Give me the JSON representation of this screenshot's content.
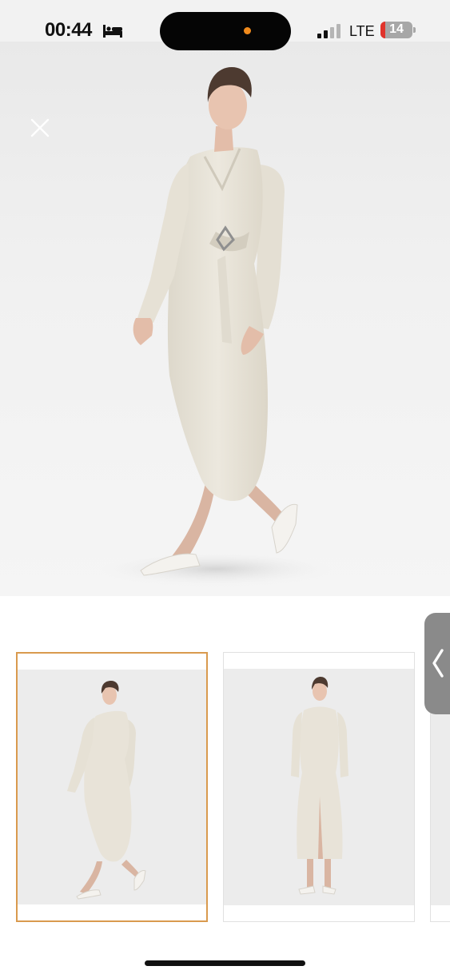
{
  "status_bar": {
    "time": "00:44",
    "focus_icon": "bed-icon",
    "signal_icon": "cellular-signal-icon",
    "network": "LTE",
    "battery_level": "14",
    "battery_fraction": 0.14,
    "battery_low_color": "#e0342c",
    "camera_indicator_color": "#f08a1c"
  },
  "viewer": {
    "close_icon": "close-icon",
    "main_image": "model-wearing-white-wrap-dress-photo"
  },
  "thumbnails": {
    "items": [
      {
        "image": "wrap-dress-walking-pose-photo",
        "selected": true
      },
      {
        "image": "wrap-dress-front-pose-photo",
        "selected": false
      },
      {
        "image": "partially-visible-thumbnail",
        "selected": false
      }
    ],
    "selected_border_color": "#d99a4e"
  },
  "side_handle": {
    "icon": "chevron-left-icon"
  }
}
